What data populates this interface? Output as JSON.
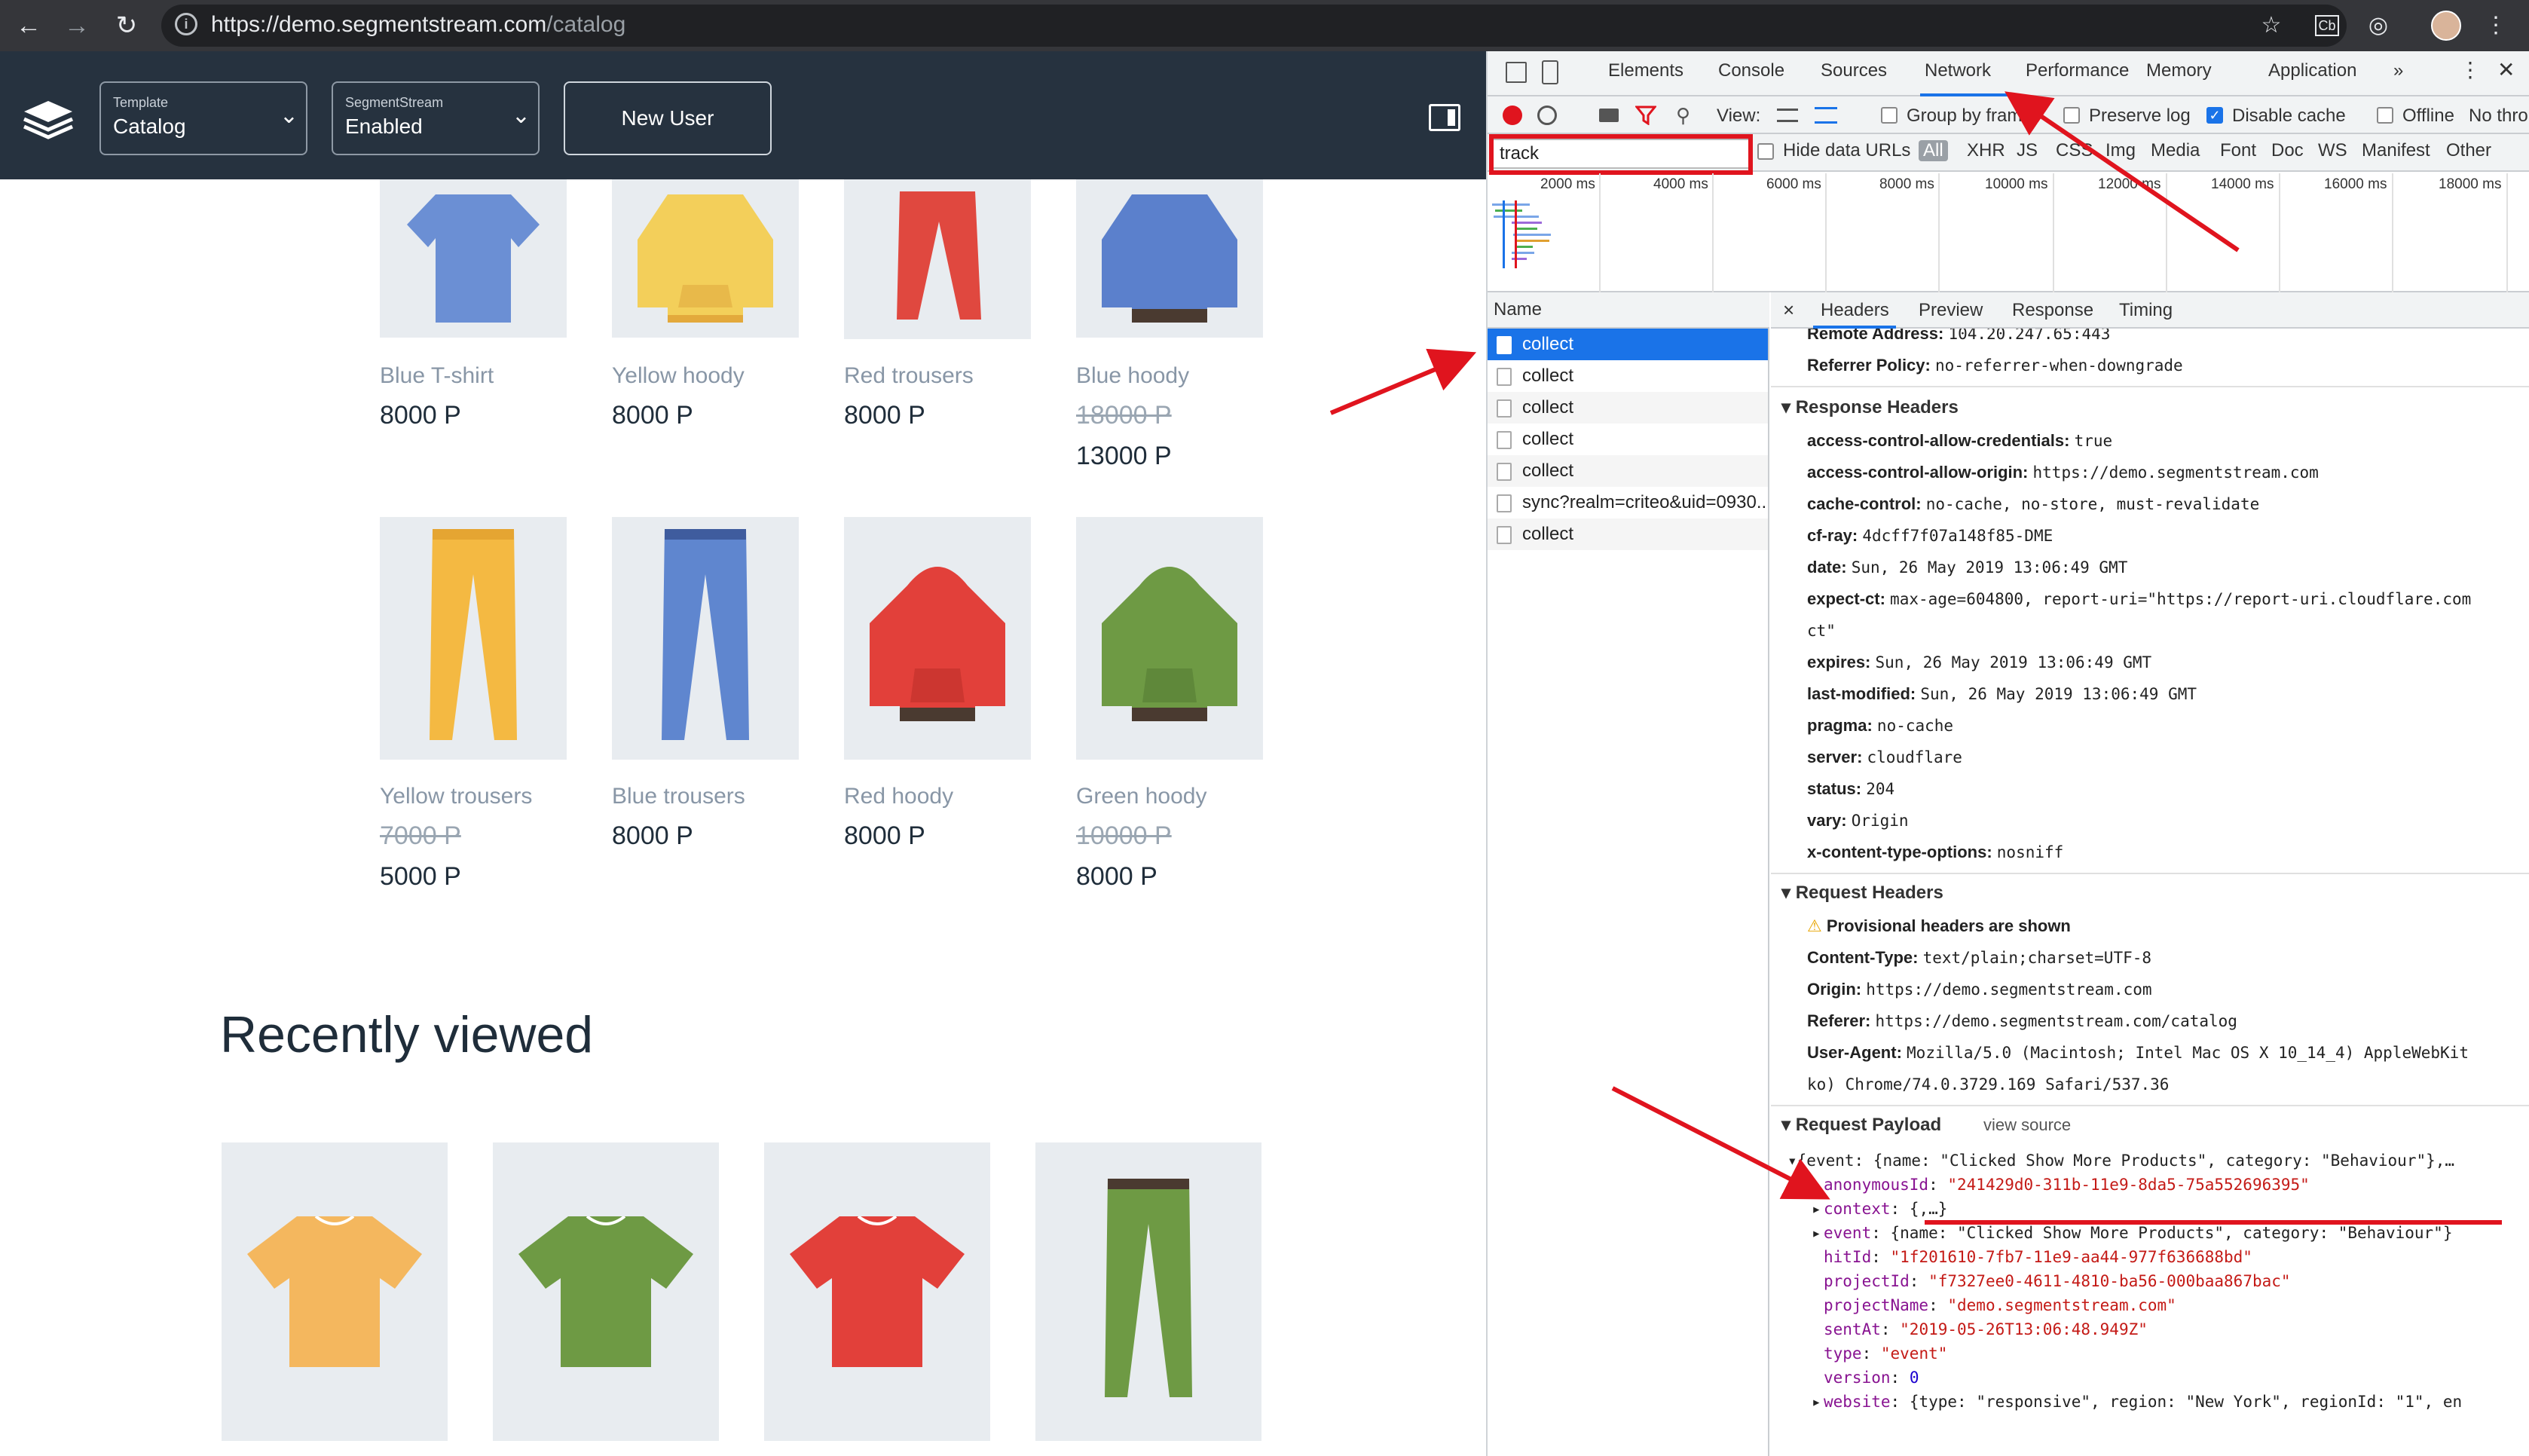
{
  "browser": {
    "url_host": "https://demo.segmentstream.com",
    "url_path": "/catalog"
  },
  "app": {
    "template_label": "Template",
    "template_value": "Catalog",
    "segmentstream_label": "SegmentStream",
    "segmentstream_value": "Enabled",
    "new_user_label": "New User"
  },
  "catalog": {
    "products": [
      {
        "name": "Blue T-shirt",
        "price": "8000 P",
        "old_price": "",
        "color": "#6b8fd4"
      },
      {
        "name": "Yellow hoody",
        "price": "8000 P",
        "old_price": "",
        "color": "#f3cf5a"
      },
      {
        "name": "Red trousers",
        "price": "8000 P",
        "old_price": "",
        "color": "#e0483f"
      },
      {
        "name": "Blue hoody",
        "price": "13000 P",
        "old_price": "18000 P",
        "color": "#5b80cc"
      },
      {
        "name": "Yellow trousers",
        "price": "5000 P",
        "old_price": "7000 P",
        "color": "#f4b942"
      },
      {
        "name": "Blue trousers",
        "price": "8000 P",
        "old_price": "",
        "color": "#5f86cf"
      },
      {
        "name": "Red hoody",
        "price": "8000 P",
        "old_price": "",
        "color": "#e2403a"
      },
      {
        "name": "Green hoody",
        "price": "8000 P",
        "old_price": "10000 P",
        "color": "#6e9a44"
      }
    ],
    "recently_viewed_title": "Recently viewed"
  },
  "devtools": {
    "tabs": [
      "Elements",
      "Console",
      "Sources",
      "Network",
      "Performance",
      "Memory",
      "Application",
      "»"
    ],
    "active_tab": "Network",
    "toolbar": {
      "view_label": "View:",
      "group_by_frame": "Group by frame",
      "preserve_log": "Preserve log",
      "disable_cache": "Disable cache",
      "offline": "Offline",
      "throttling": "No thro"
    },
    "filter_value": "track",
    "hide_data_urls": "Hide data URLs",
    "type_filters": [
      "All",
      "XHR",
      "JS",
      "CSS",
      "Img",
      "Media",
      "Font",
      "Doc",
      "WS",
      "Manifest",
      "Other"
    ],
    "timeline_ticks": [
      "2000 ms",
      "4000 ms",
      "6000 ms",
      "8000 ms",
      "10000 ms",
      "12000 ms",
      "14000 ms",
      "16000 ms",
      "18000 ms"
    ],
    "name_header": "Name",
    "requests": [
      "collect",
      "collect",
      "collect",
      "collect",
      "collect",
      "sync?realm=criteo&uid=0930...",
      "collect"
    ],
    "detail_tabs": [
      "×",
      "Headers",
      "Preview",
      "Response",
      "Timing"
    ],
    "general": [
      {
        "k": "Remote Address:",
        "v": "104.20.247.65:443"
      },
      {
        "k": "Referrer Policy:",
        "v": "no-referrer-when-downgrade"
      }
    ],
    "response_headers_title": "Response Headers",
    "response_headers": [
      {
        "k": "access-control-allow-credentials:",
        "v": "true"
      },
      {
        "k": "access-control-allow-origin:",
        "v": "https://demo.segmentstream.com"
      },
      {
        "k": "cache-control:",
        "v": "no-cache, no-store, must-revalidate"
      },
      {
        "k": "cf-ray:",
        "v": "4dcff7f07a148f85-DME"
      },
      {
        "k": "date:",
        "v": "Sun, 26 May 2019 13:06:49 GMT"
      },
      {
        "k": "expect-ct:",
        "v": "max-age=604800, report-uri=\"https://report-uri.cloudflare.com"
      },
      {
        "k": "",
        "v": "ct\""
      },
      {
        "k": "expires:",
        "v": "Sun, 26 May 2019 13:06:49 GMT"
      },
      {
        "k": "last-modified:",
        "v": "Sun, 26 May 2019 13:06:49 GMT"
      },
      {
        "k": "pragma:",
        "v": "no-cache"
      },
      {
        "k": "server:",
        "v": "cloudflare"
      },
      {
        "k": "status:",
        "v": "204"
      },
      {
        "k": "vary:",
        "v": "Origin"
      },
      {
        "k": "x-content-type-options:",
        "v": "nosniff"
      }
    ],
    "request_headers_title": "Request Headers",
    "provisional_warning": "Provisional headers are shown",
    "request_headers": [
      {
        "k": "Content-Type:",
        "v": "text/plain;charset=UTF-8"
      },
      {
        "k": "Origin:",
        "v": "https://demo.segmentstream.com"
      },
      {
        "k": "Referer:",
        "v": "https://demo.segmentstream.com/catalog"
      },
      {
        "k": "User-Agent:",
        "v": "Mozilla/5.0 (Macintosh; Intel Mac OS X 10_14_4) AppleWebKit"
      },
      {
        "k": "",
        "v": "ko) Chrome/74.0.3729.169 Safari/537.36"
      }
    ],
    "payload_title": "Request Payload",
    "view_source": "view source",
    "payload_summary": "{event: {name: \"Clicked Show More Products\", category: \"Behaviour\"},…",
    "payload_fields": [
      {
        "k": "anonymousId",
        "v": "\"241429d0-311b-11e9-8da5-75a552696395\"",
        "t": "s",
        "exp": ""
      },
      {
        "k": "context",
        "v": "{,…}",
        "t": "o",
        "exp": "▸"
      },
      {
        "k": "event",
        "v": "{name: \"Clicked Show More Products\", category: \"Behaviour\"}",
        "t": "o",
        "exp": "▸"
      },
      {
        "k": "hitId",
        "v": "\"1f201610-7fb7-11e9-aa44-977f636688bd\"",
        "t": "s",
        "exp": ""
      },
      {
        "k": "projectId",
        "v": "\"f7327ee0-4611-4810-ba56-000baa867bac\"",
        "t": "s",
        "exp": ""
      },
      {
        "k": "projectName",
        "v": "\"demo.segmentstream.com\"",
        "t": "s",
        "exp": ""
      },
      {
        "k": "sentAt",
        "v": "\"2019-05-26T13:06:48.949Z\"",
        "t": "s",
        "exp": ""
      },
      {
        "k": "type",
        "v": "\"event\"",
        "t": "s",
        "exp": ""
      },
      {
        "k": "version",
        "v": "0",
        "t": "n",
        "exp": ""
      },
      {
        "k": "website",
        "v": "{type: \"responsive\", region: \"New York\", regionId: \"1\", en",
        "t": "o",
        "exp": "▸"
      }
    ]
  }
}
